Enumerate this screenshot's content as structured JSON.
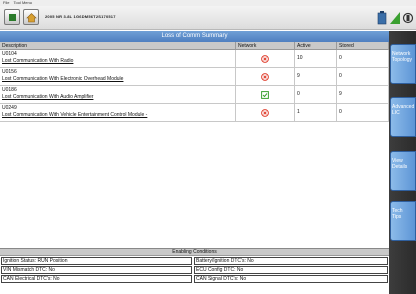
{
  "menu": {
    "file": "File",
    "tools": "Tool Menu"
  },
  "toolbar": {
    "vehicle_info": "2005 NR 3.8L 1G6DM56T2S170517"
  },
  "table": {
    "title": "Loss of Comm Summary",
    "headers": {
      "description": "Description",
      "network": "Network",
      "active": "Active",
      "stored": "Stored"
    },
    "rows": [
      {
        "code": "U0104",
        "description": "Lost Communication With Radio",
        "network_icon": "error-circle-icon",
        "active": "10",
        "stored": "0"
      },
      {
        "code": "U0156",
        "description": "Lost Communication With Electronic Overhead Module",
        "network_icon": "error-circle-icon",
        "active": "9",
        "stored": "0"
      },
      {
        "code": "U0186",
        "description": "Lost Communication With Audio Amplifier",
        "network_icon": "check-box-icon",
        "active": "0",
        "stored": "9"
      },
      {
        "code": "U0249",
        "description": "Lost Communication With Vehicle Entertainment Control Module -",
        "network_icon": "error-circle-icon",
        "active": "1",
        "stored": "0"
      }
    ]
  },
  "sidebar": {
    "network_topology": [
      "Network",
      "Topology"
    ],
    "advanced_lic": [
      "Advanced",
      "LIC"
    ],
    "view_details": [
      "View",
      "Details"
    ],
    "tech_tips": [
      "Tech",
      "Tips"
    ]
  },
  "enabling": {
    "title": "Enabling Conditions",
    "ignition_status": "Ignition Status: RUN Position",
    "battery_dtcs": "Battery/Ignition DTC's: No",
    "vin_mismatch": "VIN Mismatch DTC: No",
    "ecu_config": "ECU Config DTC: No",
    "can_electrical": "CAN Electrical DTC's: No",
    "can_signal": "CAN Signal DTC's: No"
  },
  "colors": {
    "title_bar": "#5b8bcb",
    "side_button": "#6fa3dd",
    "error": "#e04030",
    "ok": "#3aa030"
  }
}
